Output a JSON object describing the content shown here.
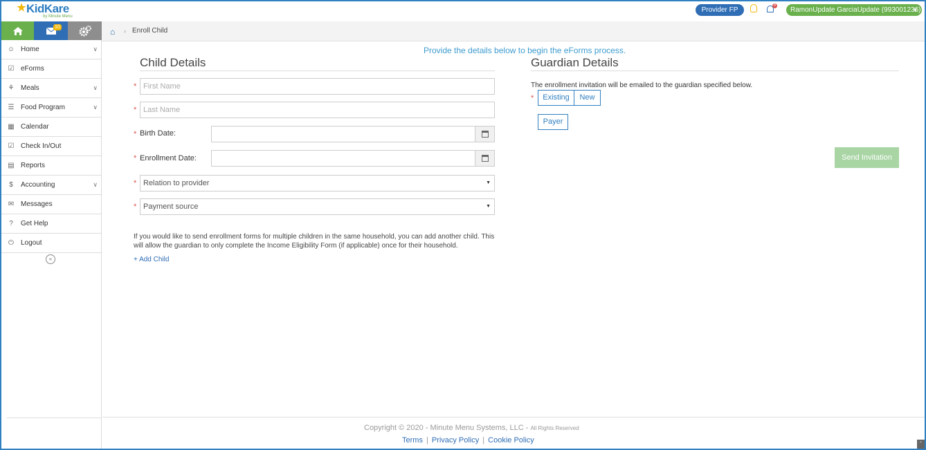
{
  "app": {
    "logo_text": "KidKare",
    "logo_tagline": "by Minute Menu"
  },
  "topbar": {
    "provider_pill": "Provider FP",
    "notifications_badge": "8",
    "user_pill": "RamonUpdate GarciaUpdate (993001236)"
  },
  "quick_actions": {
    "mail_badge": "10"
  },
  "sidebar": {
    "items": [
      {
        "label": "Home",
        "icon": "users-icon",
        "has_chevron": true
      },
      {
        "label": "eForms",
        "icon": "checkbox-icon",
        "has_chevron": false
      },
      {
        "label": "Meals",
        "icon": "utensils-icon",
        "has_chevron": true
      },
      {
        "label": "Food Program",
        "icon": "list-icon",
        "has_chevron": true
      },
      {
        "label": "Calendar",
        "icon": "calendar-icon",
        "has_chevron": false
      },
      {
        "label": "Check In/Out",
        "icon": "checkbox-icon",
        "has_chevron": false
      },
      {
        "label": "Reports",
        "icon": "report-icon",
        "has_chevron": false
      },
      {
        "label": "Accounting",
        "icon": "dollar-icon",
        "has_chevron": true
      },
      {
        "label": "Messages",
        "icon": "envelope-icon",
        "has_chevron": false
      },
      {
        "label": "Get Help",
        "icon": "question-icon",
        "has_chevron": false
      },
      {
        "label": "Logout",
        "icon": "power-icon",
        "has_chevron": false
      }
    ]
  },
  "breadcrumb": {
    "current": "Enroll Child"
  },
  "intro": "Provide the details below to begin the eForms process.",
  "child": {
    "title": "Child Details",
    "first_name_placeholder": "First Name",
    "last_name_placeholder": "Last Name",
    "birth_date_label": "Birth Date:",
    "enrollment_date_label": "Enrollment Date:",
    "relation_placeholder": "Relation to provider",
    "payment_placeholder": "Payment source",
    "help_text": "If you would like to send enrollment forms for multiple children in the same household, you can add another child. This will allow the guardian to only complete the Income Eligibility Form (if applicable) once for their household.",
    "add_child": "+ Add Child"
  },
  "guardian": {
    "title": "Guardian Details",
    "note": "The enrollment invitation will be emailed to the guardian specified below.",
    "existing": "Existing",
    "new": "New",
    "payer": "Payer",
    "send": "Send Invitation"
  },
  "footer": {
    "copyright": "Copyright © 2020 - Minute Menu Systems, LLC -",
    "rights": "All Rights Reserved",
    "terms": "Terms",
    "privacy": "Privacy Policy",
    "cookie": "Cookie Policy"
  },
  "colors": {
    "accent_blue": "#2f6db5",
    "green": "#6ab04c",
    "required": "#d9534f"
  }
}
